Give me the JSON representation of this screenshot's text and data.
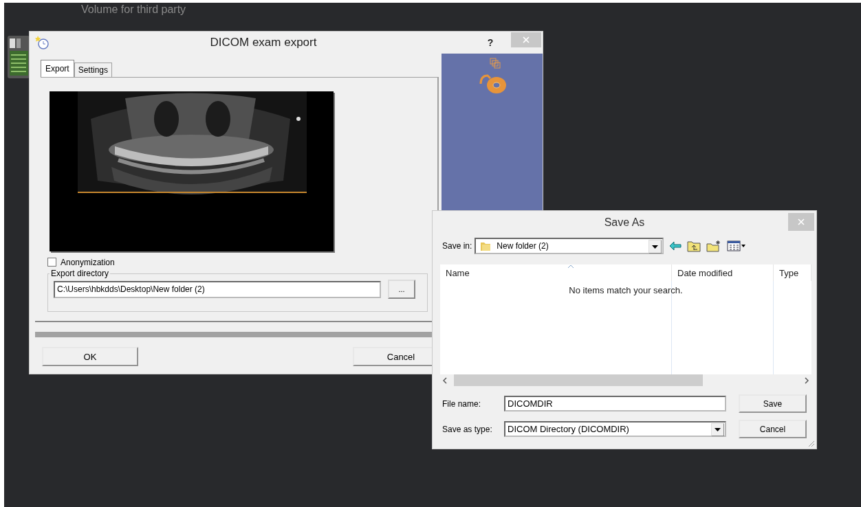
{
  "desktop": {
    "icon_label": "Volume for third party"
  },
  "export_dialog": {
    "title": "DICOM exam export",
    "help_button": "?",
    "tabs": [
      {
        "label": "Export",
        "selected": true
      },
      {
        "label": "Settings",
        "selected": false
      }
    ],
    "preview": {
      "kind": "picture"
    },
    "anonymization": {
      "label": "Anonymization",
      "checked": false
    },
    "export_directory": {
      "legend": "Export directory",
      "value": "C:\\Users\\hbkdds\\Desktop\\New folder (2)",
      "browse_button": "..."
    },
    "progress": {
      "level": 1
    },
    "buttons": [
      "OK",
      "Cancel"
    ]
  },
  "save_dialog": {
    "title": "Save As",
    "save_in": {
      "label": "Save in:",
      "value": "New folder (2)"
    },
    "columns": [
      "Name",
      "Date modified",
      "Type"
    ],
    "empty_message": "No items match your search.",
    "file_name": {
      "label": "File name:",
      "value": "DICOMDIR"
    },
    "save_as_type": {
      "label": "Save as type:",
      "value": "DICOM Directory (DICOMDIR)"
    },
    "buttons": [
      "Save",
      "Cancel"
    ]
  }
}
